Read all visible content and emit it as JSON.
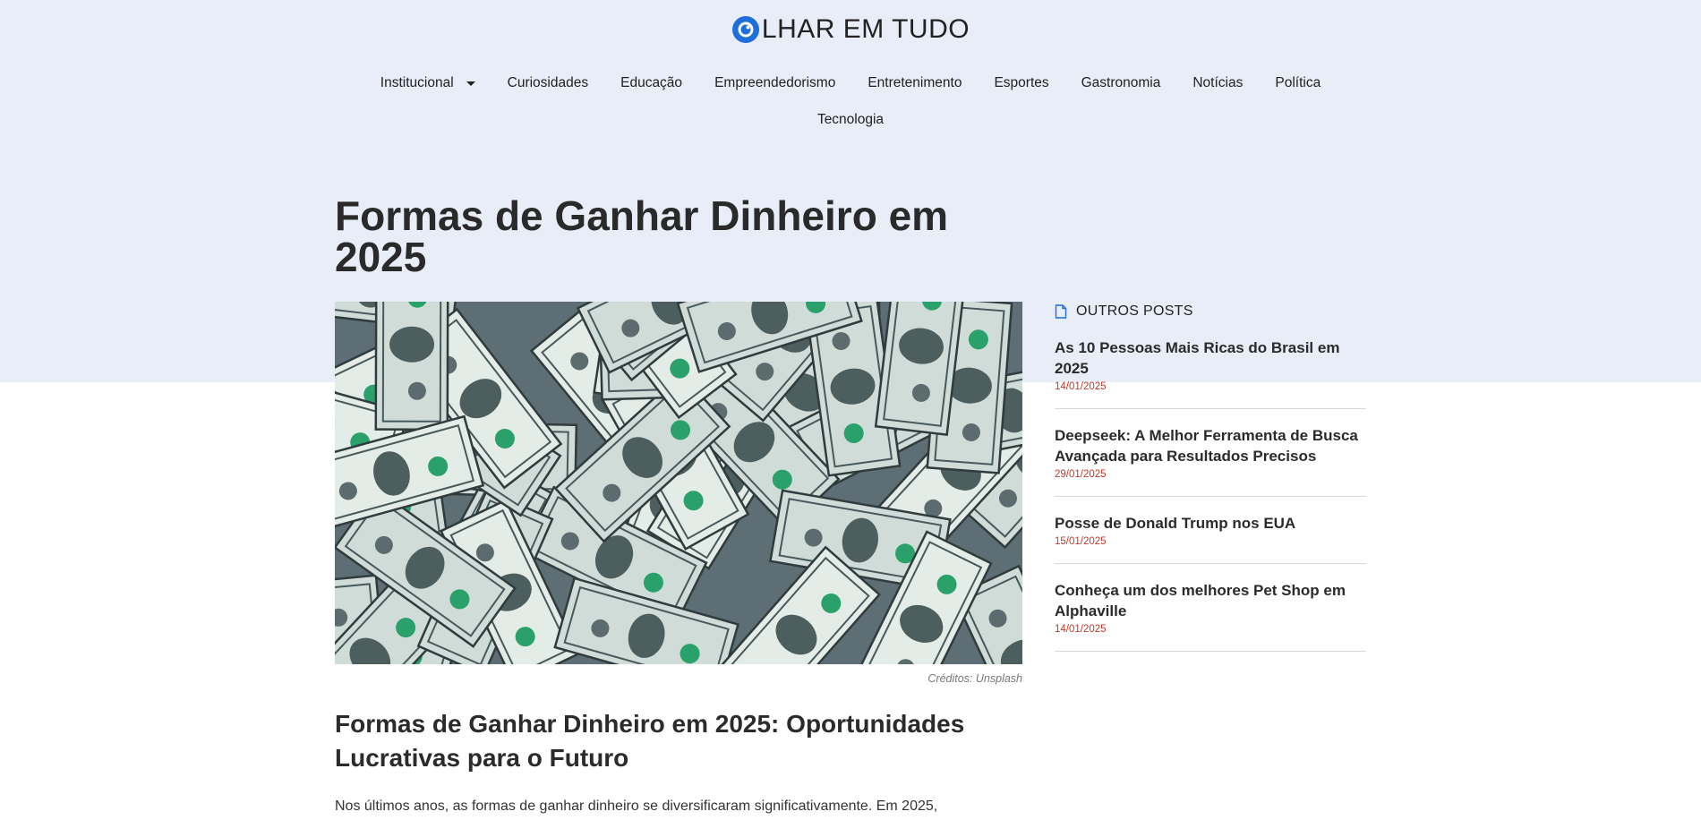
{
  "site": {
    "logo_text": "LHAR EM TUDO",
    "accent_color": "#1e6fd9"
  },
  "nav": {
    "row1": [
      "Institucional",
      "Curiosidades",
      "Educação",
      "Empreendedorismo",
      "Entretenimento",
      "Esportes",
      "Gastronomia",
      "Notícias",
      "Política"
    ],
    "row2": [
      "Tecnologia"
    ]
  },
  "article": {
    "title": "Formas de Ganhar Dinheiro em 2025",
    "image_alt_icon": "money-image",
    "image_credit": "Créditos: Unsplash",
    "heading": "Formas de Ganhar Dinheiro em 2025: Oportunidades Lucrativas para o Futuro",
    "lead": "Nos últimos anos, as formas de ganhar dinheiro se diversificaram significativamente. Em 2025,"
  },
  "sidebar": {
    "heading": "OUTROS POSTS",
    "icon": "document-icon",
    "posts": [
      {
        "title": "As 10 Pessoas Mais Ricas do Brasil em 2025",
        "date": "14/01/2025"
      },
      {
        "title": "Deepseek: A Melhor Ferramenta de Busca Avançada para Resultados Precisos",
        "date": "29/01/2025"
      },
      {
        "title": "Posse de Donald Trump nos EUA",
        "date": "15/01/2025"
      },
      {
        "title": "Conheça um dos melhores Pet Shop em Alphaville",
        "date": "14/01/2025"
      }
    ]
  },
  "colors": {
    "top_band": "#e8edf7",
    "date_red": "#c0392b"
  }
}
